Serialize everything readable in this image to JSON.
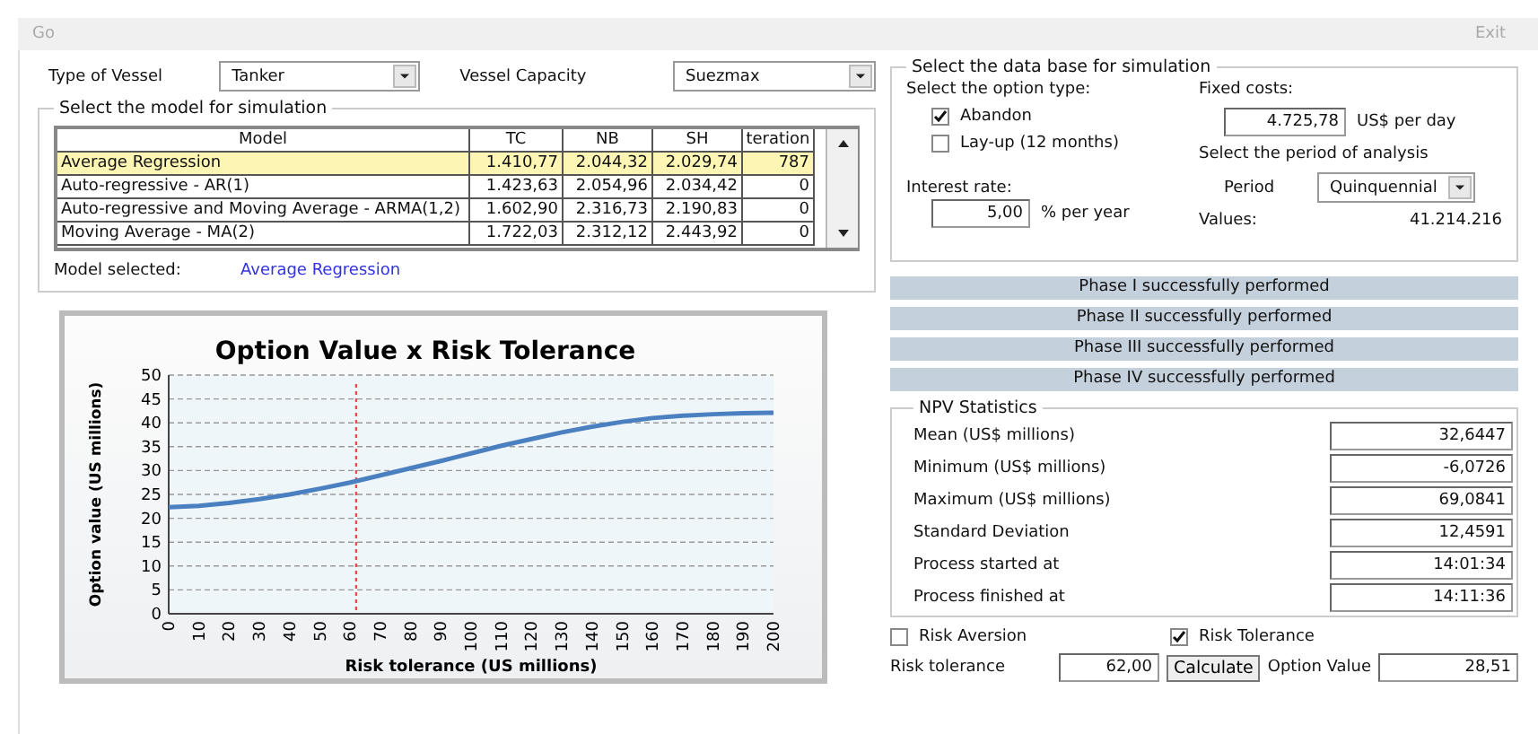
{
  "menu": {
    "left": "Go",
    "right": "Exit"
  },
  "vessel": {
    "type_label": "Type of Vessel",
    "type_value": "Tanker",
    "capacity_label": "Vessel Capacity",
    "capacity_value": "Suezmax"
  },
  "model_panel": {
    "legend": "Select the model for simulation",
    "columns": [
      "Model",
      "TC",
      "NB",
      "SH",
      "teration"
    ],
    "rows": [
      {
        "cells": [
          "Average Regression",
          "1.410,77",
          "2.044,32",
          "2.029,74",
          "787"
        ],
        "selected": true
      },
      {
        "cells": [
          "Auto-regressive  -  AR(1)",
          "1.423,63",
          "2.054,96",
          "2.034,42",
          "0"
        ],
        "selected": false
      },
      {
        "cells": [
          "Auto-regressive and Moving Average -  ARMA(1,2)",
          "1.602,90",
          "2.316,73",
          "2.190,83",
          "0"
        ],
        "selected": false
      },
      {
        "cells": [
          "Moving Average  -  MA(2)",
          "1.722,03",
          "2.312,12",
          "2.443,92",
          "0"
        ],
        "selected": false
      }
    ],
    "selected_label": "Model selected:",
    "selected_value": "Average Regression"
  },
  "chart": {
    "chart_data": {
      "type": "line",
      "title": "Option Value x Risk Tolerance",
      "xlabel": "Risk tolerance (US millions)",
      "ylabel": "Option value (US millions)",
      "x": [
        0,
        10,
        20,
        30,
        40,
        50,
        60,
        70,
        80,
        90,
        100,
        110,
        120,
        130,
        140,
        150,
        160,
        170,
        180,
        190,
        200
      ],
      "grid": true,
      "series": [
        {
          "color": "#4a7fc0",
          "values": [
            22.3,
            22.6,
            23.2,
            24,
            25,
            26.2,
            27.5,
            29,
            30.5,
            32,
            33.6,
            35.2,
            36.6,
            38,
            39.2,
            40.2,
            41,
            41.5,
            41.8,
            42,
            42.1
          ]
        }
      ],
      "xlim": [
        0,
        200
      ],
      "ylim": [
        0,
        50
      ],
      "xticks": [
        0,
        10,
        20,
        30,
        40,
        50,
        60,
        70,
        80,
        90,
        100,
        110,
        120,
        130,
        140,
        150,
        160,
        170,
        180,
        190,
        200
      ],
      "yticks": [
        0,
        5,
        10,
        15,
        20,
        25,
        30,
        35,
        40,
        45,
        50
      ],
      "ref_lines": [
        {
          "axis": "x",
          "value": 62,
          "color": "#e05050"
        }
      ]
    }
  },
  "database": {
    "legend": "Select the data base for simulation",
    "option_label": "Select the option type:",
    "options": [
      {
        "label": "Abandon",
        "checked": true
      },
      {
        "label": "Lay-up (12 months)",
        "checked": false
      }
    ],
    "interest_label": "Interest rate:",
    "interest_value": "5,00",
    "interest_unit": "% per year",
    "fixed_label": "Fixed costs:",
    "fixed_value": "4.725,78",
    "fixed_unit": "US$ per day",
    "period_title": "Select the period of analysis",
    "period_label": "Period",
    "period_value": "Quinquennial",
    "values_label": "Values:",
    "values_value": "41.214.216"
  },
  "phases": [
    "Phase I successfully performed",
    "Phase II successfully performed",
    "Phase III successfully performed",
    "Phase IV successfully performed"
  ],
  "npv": {
    "legend": "NPV Statistics",
    "rows": [
      {
        "label": "Mean (US$ millions)",
        "value": "32,6447"
      },
      {
        "label": "Minimum (US$ millions)",
        "value": "-6,0726"
      },
      {
        "label": "Maximum (US$ millions)",
        "value": "69,0841"
      },
      {
        "label": "Standard Deviation",
        "value": "12,4591"
      },
      {
        "label": "Process started at",
        "value": "14:01:34"
      },
      {
        "label": "Process finished at",
        "value": "14:11:36"
      }
    ]
  },
  "risk": {
    "modes": [
      {
        "label": "Risk Aversion",
        "checked": false
      },
      {
        "label": "Risk Tolerance",
        "checked": true
      }
    ],
    "tolerance_label": "Risk tolerance",
    "tolerance_value": "62,00",
    "calculate": "Calculate",
    "option_label": "Option Value",
    "option_value": "28,51"
  }
}
